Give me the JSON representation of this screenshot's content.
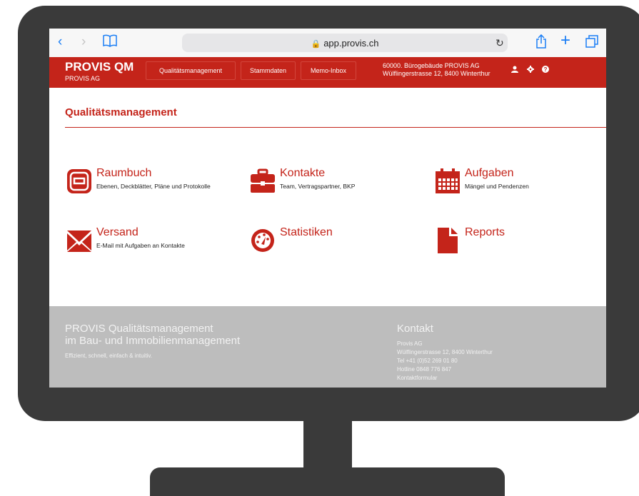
{
  "browser": {
    "url": "app.provis.ch"
  },
  "app": {
    "brand_title": "PROVIS QM",
    "brand_sub": "PROVIS AG",
    "nav": [
      "Qualitätsmanagement",
      "Stammdaten",
      "Memo-Inbox"
    ],
    "address_line1": "60000. Bürogebäude PROVIS AG",
    "address_line2": "Wülflingerstrasse 12, 8400 Winterthur",
    "accent_color": "#c4241a"
  },
  "page": {
    "title": "Qualitätsmanagement"
  },
  "tiles": [
    {
      "title": "Raumbuch",
      "desc": "Ebenen, Deckblätter, Pläne und Protokolle",
      "icon": "building-icon"
    },
    {
      "title": "Kontakte",
      "desc": "Team, Vertragspartner, BKP",
      "icon": "briefcase-icon"
    },
    {
      "title": "Aufgaben",
      "desc": "Mängel und Pendenzen",
      "icon": "calendar-icon"
    },
    {
      "title": "Versand",
      "desc": "E-Mail mit Aufgaben an Kontakte",
      "icon": "envelope-icon"
    },
    {
      "title": "Statistiken",
      "desc": "",
      "icon": "dashboard-icon"
    },
    {
      "title": "Reports",
      "desc": "",
      "icon": "document-icon"
    }
  ],
  "footer": {
    "title_line1": "PROVIS Qualitätsmanagement",
    "title_line2": "im Bau- und Immobilienmanagement",
    "tagline": "Effizient, schnell, einfach & intuitiv.",
    "contact_title": "Kontakt",
    "contact_lines": [
      "Provis AG",
      "Wülflingerstrasse 12, 8400 Winterthur",
      "Tel +41 (0)52 269 01 80",
      "Hotline 0848 776 847",
      "Kontaktformular"
    ]
  }
}
